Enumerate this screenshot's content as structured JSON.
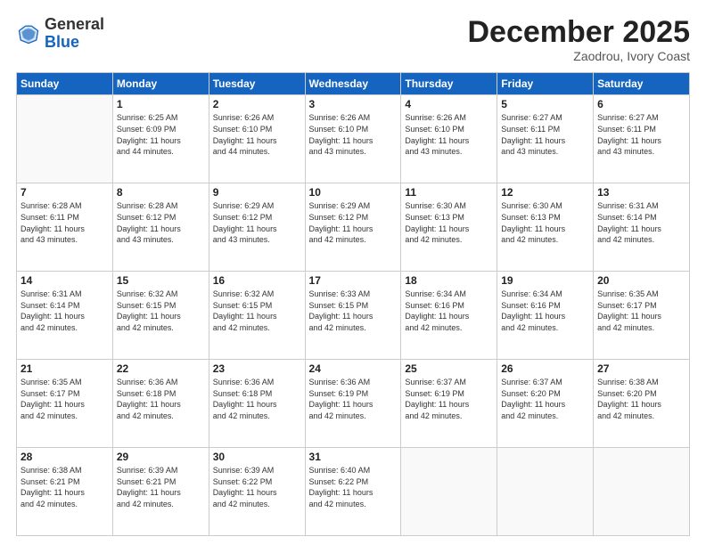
{
  "header": {
    "logo_general": "General",
    "logo_blue": "Blue",
    "month_title": "December 2025",
    "subtitle": "Zaodrou, Ivory Coast"
  },
  "days_of_week": [
    "Sunday",
    "Monday",
    "Tuesday",
    "Wednesday",
    "Thursday",
    "Friday",
    "Saturday"
  ],
  "weeks": [
    [
      {
        "day": "",
        "info": ""
      },
      {
        "day": "1",
        "info": "Sunrise: 6:25 AM\nSunset: 6:09 PM\nDaylight: 11 hours\nand 44 minutes."
      },
      {
        "day": "2",
        "info": "Sunrise: 6:26 AM\nSunset: 6:10 PM\nDaylight: 11 hours\nand 44 minutes."
      },
      {
        "day": "3",
        "info": "Sunrise: 6:26 AM\nSunset: 6:10 PM\nDaylight: 11 hours\nand 43 minutes."
      },
      {
        "day": "4",
        "info": "Sunrise: 6:26 AM\nSunset: 6:10 PM\nDaylight: 11 hours\nand 43 minutes."
      },
      {
        "day": "5",
        "info": "Sunrise: 6:27 AM\nSunset: 6:11 PM\nDaylight: 11 hours\nand 43 minutes."
      },
      {
        "day": "6",
        "info": "Sunrise: 6:27 AM\nSunset: 6:11 PM\nDaylight: 11 hours\nand 43 minutes."
      }
    ],
    [
      {
        "day": "7",
        "info": "Sunrise: 6:28 AM\nSunset: 6:11 PM\nDaylight: 11 hours\nand 43 minutes."
      },
      {
        "day": "8",
        "info": "Sunrise: 6:28 AM\nSunset: 6:12 PM\nDaylight: 11 hours\nand 43 minutes."
      },
      {
        "day": "9",
        "info": "Sunrise: 6:29 AM\nSunset: 6:12 PM\nDaylight: 11 hours\nand 43 minutes."
      },
      {
        "day": "10",
        "info": "Sunrise: 6:29 AM\nSunset: 6:12 PM\nDaylight: 11 hours\nand 42 minutes."
      },
      {
        "day": "11",
        "info": "Sunrise: 6:30 AM\nSunset: 6:13 PM\nDaylight: 11 hours\nand 42 minutes."
      },
      {
        "day": "12",
        "info": "Sunrise: 6:30 AM\nSunset: 6:13 PM\nDaylight: 11 hours\nand 42 minutes."
      },
      {
        "day": "13",
        "info": "Sunrise: 6:31 AM\nSunset: 6:14 PM\nDaylight: 11 hours\nand 42 minutes."
      }
    ],
    [
      {
        "day": "14",
        "info": "Sunrise: 6:31 AM\nSunset: 6:14 PM\nDaylight: 11 hours\nand 42 minutes."
      },
      {
        "day": "15",
        "info": "Sunrise: 6:32 AM\nSunset: 6:15 PM\nDaylight: 11 hours\nand 42 minutes."
      },
      {
        "day": "16",
        "info": "Sunrise: 6:32 AM\nSunset: 6:15 PM\nDaylight: 11 hours\nand 42 minutes."
      },
      {
        "day": "17",
        "info": "Sunrise: 6:33 AM\nSunset: 6:15 PM\nDaylight: 11 hours\nand 42 minutes."
      },
      {
        "day": "18",
        "info": "Sunrise: 6:34 AM\nSunset: 6:16 PM\nDaylight: 11 hours\nand 42 minutes."
      },
      {
        "day": "19",
        "info": "Sunrise: 6:34 AM\nSunset: 6:16 PM\nDaylight: 11 hours\nand 42 minutes."
      },
      {
        "day": "20",
        "info": "Sunrise: 6:35 AM\nSunset: 6:17 PM\nDaylight: 11 hours\nand 42 minutes."
      }
    ],
    [
      {
        "day": "21",
        "info": "Sunrise: 6:35 AM\nSunset: 6:17 PM\nDaylight: 11 hours\nand 42 minutes."
      },
      {
        "day": "22",
        "info": "Sunrise: 6:36 AM\nSunset: 6:18 PM\nDaylight: 11 hours\nand 42 minutes."
      },
      {
        "day": "23",
        "info": "Sunrise: 6:36 AM\nSunset: 6:18 PM\nDaylight: 11 hours\nand 42 minutes."
      },
      {
        "day": "24",
        "info": "Sunrise: 6:36 AM\nSunset: 6:19 PM\nDaylight: 11 hours\nand 42 minutes."
      },
      {
        "day": "25",
        "info": "Sunrise: 6:37 AM\nSunset: 6:19 PM\nDaylight: 11 hours\nand 42 minutes."
      },
      {
        "day": "26",
        "info": "Sunrise: 6:37 AM\nSunset: 6:20 PM\nDaylight: 11 hours\nand 42 minutes."
      },
      {
        "day": "27",
        "info": "Sunrise: 6:38 AM\nSunset: 6:20 PM\nDaylight: 11 hours\nand 42 minutes."
      }
    ],
    [
      {
        "day": "28",
        "info": "Sunrise: 6:38 AM\nSunset: 6:21 PM\nDaylight: 11 hours\nand 42 minutes."
      },
      {
        "day": "29",
        "info": "Sunrise: 6:39 AM\nSunset: 6:21 PM\nDaylight: 11 hours\nand 42 minutes."
      },
      {
        "day": "30",
        "info": "Sunrise: 6:39 AM\nSunset: 6:22 PM\nDaylight: 11 hours\nand 42 minutes."
      },
      {
        "day": "31",
        "info": "Sunrise: 6:40 AM\nSunset: 6:22 PM\nDaylight: 11 hours\nand 42 minutes."
      },
      {
        "day": "",
        "info": ""
      },
      {
        "day": "",
        "info": ""
      },
      {
        "day": "",
        "info": ""
      }
    ]
  ]
}
